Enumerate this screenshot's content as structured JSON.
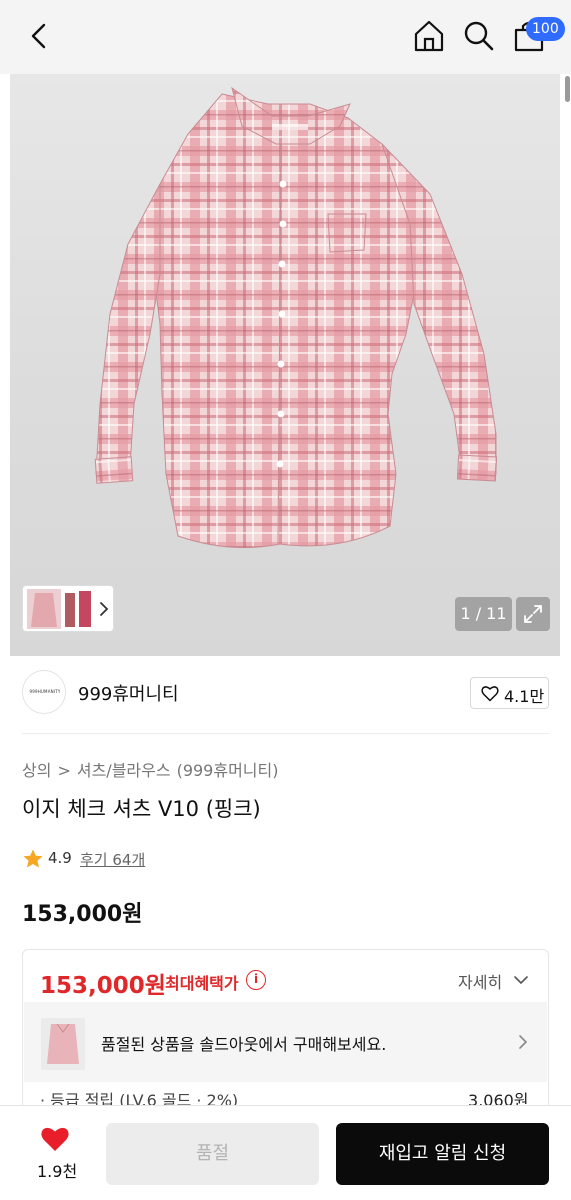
{
  "header": {
    "back_icon": "chevron-left-icon",
    "home_icon": "home-icon",
    "search_icon": "search-icon",
    "cart_icon": "shopping-bag-icon",
    "cart_badge": "100",
    "badge_color": "#2f6bff"
  },
  "gallery": {
    "pager": "1 / 11",
    "expand_icon": "expand-icon",
    "thumbnail_arrow_icon": "chevron-right-icon"
  },
  "brand": {
    "logo_text": "999HUMANITY",
    "name": "999휴머니티",
    "like_count": "4.1만"
  },
  "breadcrumb": [
    "상의",
    ">",
    "셔츠/블라우스",
    "(999휴머니티)"
  ],
  "product": {
    "title": "이지 체크 셔츠 V10 (핑크)",
    "rating": "4.9",
    "reviews": "후기 64개",
    "price": "153,000원"
  },
  "benefit": {
    "price": "153,000원",
    "label": "최대혜택가",
    "info": "i",
    "detail": "자세히",
    "soldout_message": "품절된 상품을 솔드아웃에서 구매해보세요.",
    "points_label": "· 등급 적립 (LV.6 골드 · 2%)",
    "points_value": "3,060원",
    "accent_color": "#e0282a"
  },
  "bottom": {
    "wish_count": "1.9천",
    "soldout_button": "품절",
    "restock_button": "재입고 알림 신청"
  }
}
